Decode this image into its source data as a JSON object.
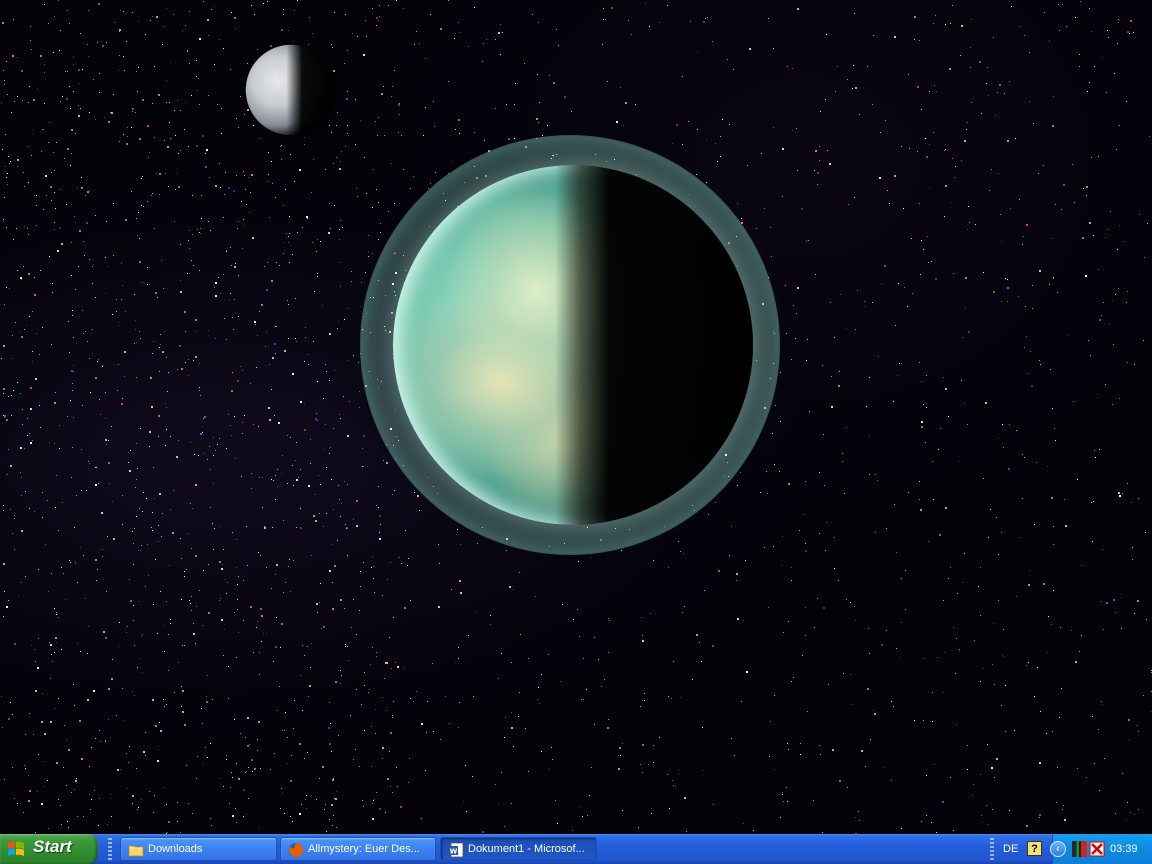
{
  "desktop": {
    "wallpaper": "space scene with planet, moon and star field"
  },
  "taskbar": {
    "start_label": "Start",
    "tasks": [
      {
        "label": "Downloads",
        "icon": "folder-icon",
        "active": false
      },
      {
        "label": "Allmystery: Euer Des...",
        "icon": "firefox-icon",
        "active": false
      },
      {
        "label": "Dokument1 - Microsof...",
        "icon": "word-icon",
        "active": true
      }
    ],
    "tray": {
      "language": "DE",
      "help_glyph": "?",
      "clock": "03:39"
    }
  },
  "colors": {
    "taskbar_blue": "#245edb",
    "start_green": "#3c9b3a",
    "tray_blue": "#0f8de4"
  }
}
